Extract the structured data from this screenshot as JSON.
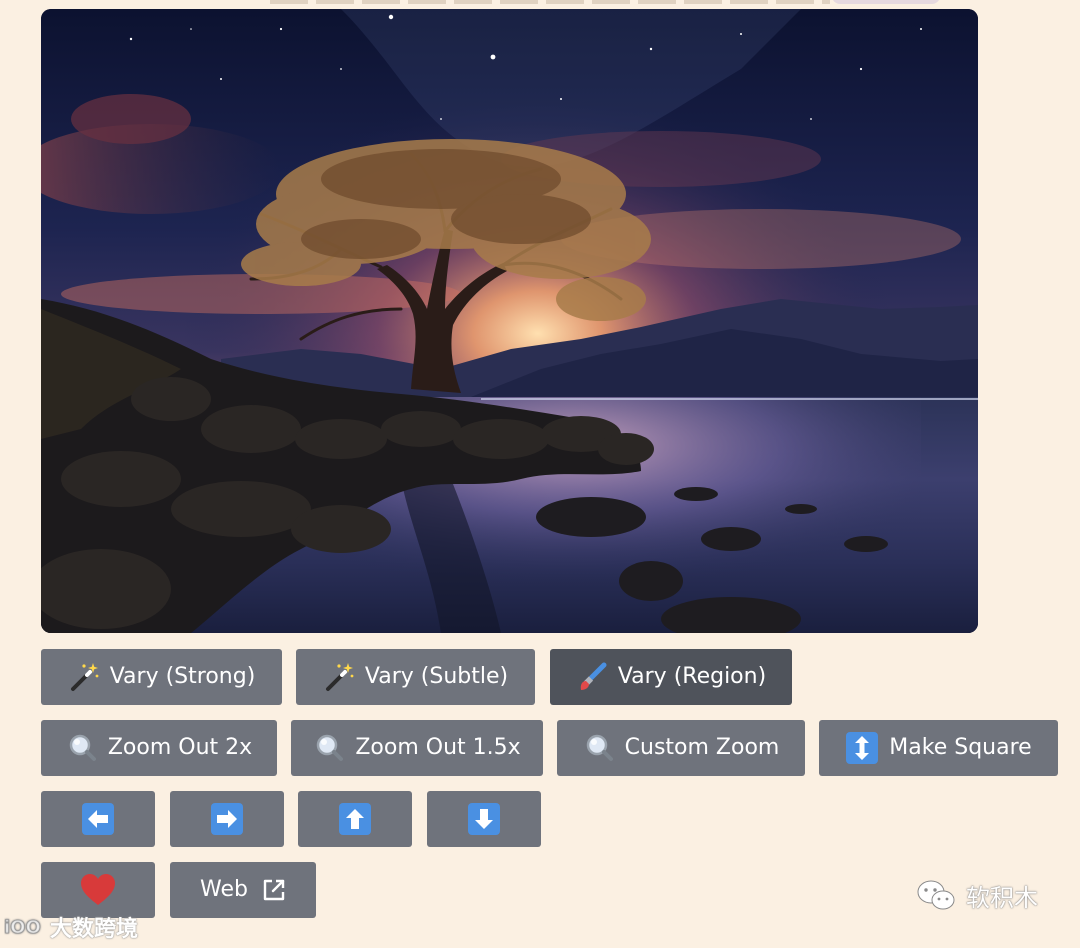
{
  "image": {
    "alt": "Generated image: lone tree on a rocky lakeshore under a starry night sky with a glowing sunset behind mountains"
  },
  "variation_row": [
    {
      "label": "Vary (Strong)",
      "icon": "magic-wand-icon"
    },
    {
      "label": "Vary (Subtle)",
      "icon": "magic-wand-icon"
    },
    {
      "label": "Vary (Region)",
      "icon": "paintbrush-icon",
      "active": true
    }
  ],
  "zoom_row": [
    {
      "label": "Zoom Out 2x",
      "icon": "magnifier-icon"
    },
    {
      "label": "Zoom Out 1.5x",
      "icon": "magnifier-icon"
    },
    {
      "label": "Custom Zoom",
      "icon": "magnifier-icon"
    },
    {
      "label": "Make Square",
      "icon": "up-down-arrow-icon"
    }
  ],
  "pan_row": [
    {
      "icon": "arrow-left-icon"
    },
    {
      "icon": "arrow-right-icon"
    },
    {
      "icon": "arrow-up-icon"
    },
    {
      "icon": "arrow-down-icon"
    }
  ],
  "misc_row": {
    "favorite_icon": "heart-icon",
    "web_label": "Web",
    "web_icon": "external-link-icon"
  },
  "watermarks": {
    "left": "大数跨境",
    "right": "软积木"
  },
  "colors": {
    "page_background": "#fbf0e2",
    "button": "#6f737c",
    "button_active": "#4f535b",
    "arrow_emoji_blue": "#4a90e2",
    "heart": "#d83a3a"
  }
}
